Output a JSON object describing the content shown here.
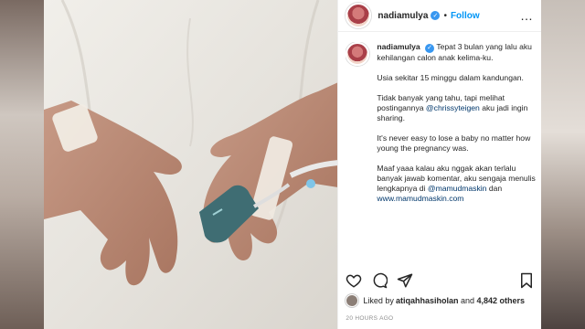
{
  "post": {
    "username": "nadiamulya",
    "follow_label": "Follow",
    "more_icon": "…"
  },
  "caption": {
    "username": "nadiamulya",
    "line1": "Tepat 3 bulan yang lalu aku kehilangan calon anak kelima-ku.",
    "line2": "Usia sekitar 15 minggu dalam kandungan.",
    "line3_pre": "Tidak banyak yang tahu, tapi melihat postingannya ",
    "line3_mention": "@chrissyteigen",
    "line3_post": " aku jadi ingin sharing.",
    "line4": "It's never easy to lose a baby no matter how young the pregnancy was.",
    "line5_pre": "Maaf yaaa kalau aku nggak akan terlalu banyak jawab komentar, aku sengaja menulis lengkapnya di ",
    "line5_mention": "@mamudmaskin",
    "line5_post": " dan",
    "line6": "www.mamudmaskin.com"
  },
  "likes": {
    "prefix": "Liked by ",
    "user": "atiqahhasiholan",
    "middle": " and ",
    "count": "4,842 others"
  },
  "timestamp": "20 HOURS AGO",
  "colors": {
    "accent": "#0095f6",
    "verified": "#3897f0",
    "text": "#262626"
  }
}
